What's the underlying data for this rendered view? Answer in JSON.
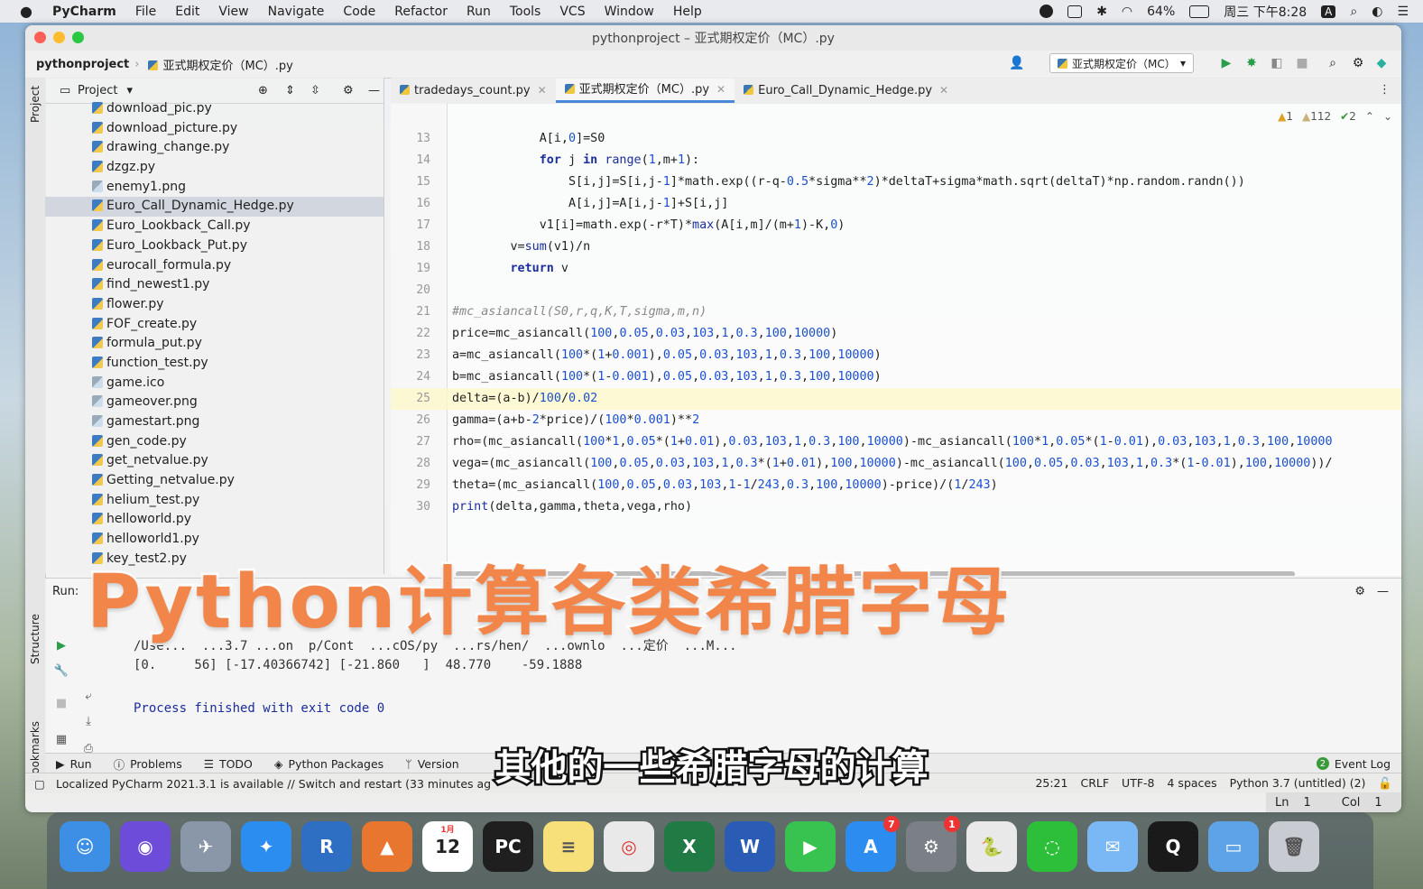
{
  "menubar": {
    "app": "PyCharm",
    "items": [
      "File",
      "Edit",
      "View",
      "Navigate",
      "Code",
      "Refactor",
      "Run",
      "Tools",
      "VCS",
      "Window",
      "Help"
    ],
    "battery": "64%",
    "clock": "周三 下午8:28",
    "input_method": "A"
  },
  "window": {
    "title": "pythonproject – 亚式期权定价（MC）.py",
    "breadcrumb_project": "pythonproject",
    "breadcrumb_file": "亚式期权定价（MC）.py",
    "run_config": "亚式期权定价（MC）"
  },
  "sidebar": {
    "project_tab": "Project",
    "structure_tab": "Structure",
    "bookmarks_tab": "Bookmarks"
  },
  "project": {
    "header": "Project",
    "files": [
      {
        "name": "download_pic.py",
        "type": "py"
      },
      {
        "name": "download_picture.py",
        "type": "py"
      },
      {
        "name": "drawing_change.py",
        "type": "py"
      },
      {
        "name": "dzgz.py",
        "type": "py"
      },
      {
        "name": "enemy1.png",
        "type": "img"
      },
      {
        "name": "Euro_Call_Dynamic_Hedge.py",
        "type": "py",
        "selected": true
      },
      {
        "name": "Euro_Lookback_Call.py",
        "type": "py"
      },
      {
        "name": "Euro_Lookback_Put.py",
        "type": "py"
      },
      {
        "name": "eurocall_formula.py",
        "type": "py"
      },
      {
        "name": "find_newest1.py",
        "type": "py"
      },
      {
        "name": "flower.py",
        "type": "py"
      },
      {
        "name": "FOF_create.py",
        "type": "py"
      },
      {
        "name": "formula_put.py",
        "type": "py"
      },
      {
        "name": "function_test.py",
        "type": "py"
      },
      {
        "name": "game.ico",
        "type": "img"
      },
      {
        "name": "gameover.png",
        "type": "img"
      },
      {
        "name": "gamestart.png",
        "type": "img"
      },
      {
        "name": "gen_code.py",
        "type": "py"
      },
      {
        "name": "get_netvalue.py",
        "type": "py"
      },
      {
        "name": "Getting_netvalue.py",
        "type": "py"
      },
      {
        "name": "helium_test.py",
        "type": "py"
      },
      {
        "name": "helloworld.py",
        "type": "py"
      },
      {
        "name": "helloworld1.py",
        "type": "py"
      },
      {
        "name": "key_test2.py",
        "type": "py"
      }
    ]
  },
  "editor": {
    "tabs": [
      {
        "label": "tradedays_count.py",
        "active": false
      },
      {
        "label": "亚式期权定价（MC）.py",
        "active": true
      },
      {
        "label": "Euro_Call_Dynamic_Hedge.py",
        "active": false
      }
    ],
    "inspections": {
      "errors": "1",
      "warnings": "112",
      "ok": "2"
    },
    "current_line": 25,
    "lines": [
      {
        "n": "13",
        "code": "            A[i,0]=S0"
      },
      {
        "n": "14",
        "code": "            for j in range(1,m+1):"
      },
      {
        "n": "15",
        "code": "                S[i,j]=S[i,j-1]*math.exp((r-q-0.5*sigma**2)*deltaT+sigma*math.sqrt(deltaT)*np.random.randn())"
      },
      {
        "n": "16",
        "code": "                A[i,j]=A[i,j-1]+S[i,j]"
      },
      {
        "n": "17",
        "code": "            v1[i]=math.exp(-r*T)*max(A[i,m]/(m+1)-K,0)"
      },
      {
        "n": "18",
        "code": "        v=sum(v1)/n"
      },
      {
        "n": "19",
        "code": "        return v"
      },
      {
        "n": "20",
        "code": ""
      },
      {
        "n": "21",
        "code": "#mc_asiancall(S0,r,q,K,T,sigma,m,n)"
      },
      {
        "n": "22",
        "code": "price=mc_asiancall(100,0.05,0.03,103,1,0.3,100,10000)"
      },
      {
        "n": "23",
        "code": "a=mc_asiancall(100*(1+0.001),0.05,0.03,103,1,0.3,100,10000)"
      },
      {
        "n": "24",
        "code": "b=mc_asiancall(100*(1-0.001),0.05,0.03,103,1,0.3,100,10000)"
      },
      {
        "n": "25",
        "code": "delta=(a-b)/100/0.02"
      },
      {
        "n": "26",
        "code": "gamma=(a+b-2*price)/(100*0.001)**2"
      },
      {
        "n": "27",
        "code": "rho=(mc_asiancall(100*1,0.05*(1+0.01),0.03,103,1,0.3,100,10000)-mc_asiancall(100*1,0.05*(1-0.01),0.03,103,1,0.3,100,10000"
      },
      {
        "n": "28",
        "code": "vega=(mc_asiancall(100,0.05,0.03,103,1,0.3*(1+0.01),100,10000)-mc_asiancall(100,0.05,0.03,103,1,0.3*(1-0.01),100,10000))/"
      },
      {
        "n": "29",
        "code": "theta=(mc_asiancall(100,0.05,0.03,103,1-1/243,0.3,100,10000)-price)/(1/243)"
      },
      {
        "n": "30",
        "code": "print(delta,gamma,theta,vega,rho)"
      }
    ]
  },
  "run": {
    "label": "Run:",
    "cmd_line": "/Use...  ...3.7 ...on  p/Cont  ...cOS/py  ...rs/hen/  ...ownlo  ...定价  ...M...",
    "result_line": "[0.     56] [-17.40366742] [-21.860   ]  48.770    -59.1888",
    "exit_line": "Process finished with exit code 0"
  },
  "tool_tabs": [
    "Run",
    "Problems",
    "TODO",
    "Python Packages",
    "Version"
  ],
  "event_log": "Event Log",
  "event_log_count": "2",
  "status": {
    "message": "Localized PyCharm 2021.3.1 is available // Switch and restart (33 minutes ag",
    "position": "25:21",
    "line_sep": "CRLF",
    "encoding": "UTF-8",
    "indent": "4 spaces",
    "interpreter": "Python 3.7 (untitled) (2)"
  },
  "lncol": {
    "ln_label": "Ln",
    "ln": "1",
    "col_label": "Col",
    "col": "1"
  },
  "overlay": {
    "title": "Python计算各类希腊字母",
    "subtitle": "其他的一些希腊字母的计算"
  },
  "dock": {
    "apps": [
      {
        "name": "Finder",
        "color": "#3d8fe6",
        "label": "☺"
      },
      {
        "name": "Siri",
        "color": "#6c4cd8",
        "label": "◉"
      },
      {
        "name": "Launchpad",
        "color": "#8a97a8",
        "label": "✈"
      },
      {
        "name": "Safari",
        "color": "#2b8df0",
        "label": "✦"
      },
      {
        "name": "R",
        "color": "#2e6fc4",
        "label": "R"
      },
      {
        "name": "MATLAB",
        "color": "#e8762e",
        "label": "▲"
      },
      {
        "name": "Calendar",
        "color": "#ffffff",
        "label": "12",
        "fg": "#222",
        "month": "1月"
      },
      {
        "name": "PyCharm",
        "color": "#1f1f1f",
        "label": "PC"
      },
      {
        "name": "Notes",
        "color": "#f7e07a",
        "label": "≡",
        "fg": "#555"
      },
      {
        "name": "Chrome",
        "color": "#e9e9e9",
        "label": "◎",
        "fg": "#d33"
      },
      {
        "name": "Excel",
        "color": "#1f7a44",
        "label": "X"
      },
      {
        "name": "Word",
        "color": "#2a5bb5",
        "label": "W"
      },
      {
        "name": "FaceTime",
        "color": "#38c24f",
        "label": "▶"
      },
      {
        "name": "App Store",
        "color": "#2d8cf0",
        "label": "A",
        "badge": "7"
      },
      {
        "name": "System Preferences",
        "color": "#7b7f86",
        "label": "⚙",
        "badge": "1"
      },
      {
        "name": "Python Launcher",
        "color": "#e9e9e9",
        "label": "🐍",
        "fg": "#2f6aa8"
      },
      {
        "name": "WeChat",
        "color": "#2dbf3a",
        "label": "◌"
      },
      {
        "name": "Mail",
        "color": "#7ab8f5",
        "label": "✉"
      },
      {
        "name": "QuickTime",
        "color": "#1a1a1a",
        "label": "Q"
      },
      {
        "name": "Folder",
        "color": "#5ea3e8",
        "label": "▭"
      },
      {
        "name": "Trash",
        "color": "#c8ccd2",
        "label": "🗑",
        "fg": "#555"
      }
    ]
  },
  "colors": {
    "accent": "#4a88d8",
    "title_orange": "#f2864a",
    "keyword": "#1c2d9c",
    "number": "#1a50d0"
  }
}
